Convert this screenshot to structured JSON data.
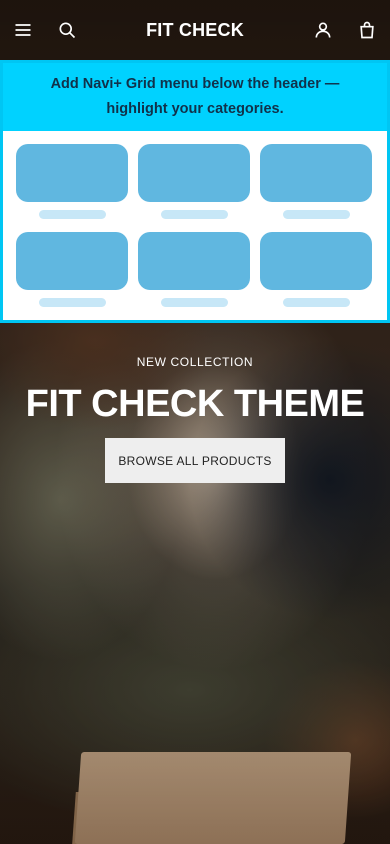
{
  "header": {
    "brand": "FIT CHECK",
    "menu_icon": "hamburger-menu-icon",
    "search_icon": "search-icon",
    "account_icon": "user-icon",
    "cart_icon": "shopping-bag-icon"
  },
  "callout": {
    "message": "Add Navi+ Grid menu below the header — highlight your categories.",
    "banner_color": "#00d2ff",
    "border_color": "#00c6f3",
    "tile_color": "#60b7e0",
    "label_bar_color": "#c7e7f7",
    "grid_items": [
      {},
      {},
      {},
      {},
      {},
      {}
    ]
  },
  "hero": {
    "eyebrow": "NEW COLLECTION",
    "title": "FIT CHECK THEME",
    "cta_label": "BROWSE ALL PRODUCTS"
  }
}
